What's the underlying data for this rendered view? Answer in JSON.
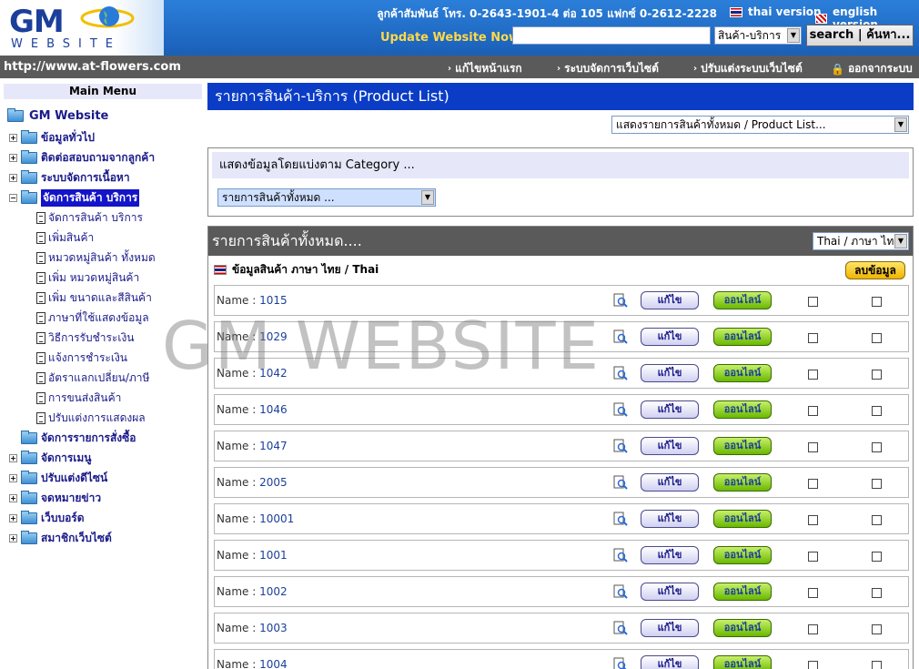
{
  "header": {
    "logo_main": "GM",
    "logo_sub": "WEBSITE",
    "contact": "ลูกค้าสัมพันธ์ โทร. 0-2643-1901-4 ต่อ 105 แฟกซ์ 0-2612-2228",
    "thai_version": "thai version",
    "english_version": "english version",
    "update_label": "Update Website Now!",
    "search_value": "",
    "search_category": "สินค้า-บริการ",
    "search_button": "search | ค้นหา..."
  },
  "navbar": {
    "url": "http://www.at-flowers.com",
    "links": [
      "แก้ไขหน้าแรก",
      "ระบบจัดการเว็บไซต์",
      "ปรับแต่งระบบเว็บไซต์",
      "ออกจากระบบ"
    ]
  },
  "sidebar": {
    "title": "Main Menu",
    "root": "GM Website",
    "items": [
      "ข้อมูลทั่วไป",
      "ติดต่อสอบถามจากลูกค้า",
      "ระบบจัดการเนื้อหา",
      "จัดการสินค้า บริการ",
      "จัดการรายการสั่งซื้อ",
      "จัดการเมนู",
      "ปรับแต่งดีไซน์",
      "จดหมายข่าว",
      "เว็บบอร์ด",
      "สมาชิกเว็บไซต์"
    ],
    "subitems": [
      "จัดการสินค้า บริการ",
      "เพิ่มสินค้า",
      "หมวดหมู่สินค้า ทั้งหมด",
      "เพิ่ม หมวดหมู่สินค้า",
      "เพิ่ม ขนาดและสีสินค้า",
      "ภาษาที่ใช้แสดงข้อมูล",
      "วิธีการรับชำระเงิน",
      "แจ้งการชำระเงิน",
      "อัตราแลกเปลี่ยน/ภาษี",
      "การขนส่งสินค้า",
      "ปรับแต่งการแสดงผล"
    ]
  },
  "main": {
    "page_title": "รายการสินค้า-บริการ (Product List)",
    "list_select": "แสดงรายการสินค้าทั้งหมด / Product List...",
    "category_heading": "แสดงข้อมูลโดยแบ่งตาม Category ...",
    "category_select": "รายการสินค้าทั้งหมด ...",
    "list_heading": "รายการสินค้าทั้งหมด....",
    "lang_filter": "Thai / ภาษา ไทย",
    "lang_row": "ข้อมูลสินค้า ภาษา ไทย / Thai",
    "delete_button": "ลบข้อมูล",
    "name_label": "Name : ",
    "edit_label": "แก้ไข",
    "online_label": "ออนไลน์",
    "rows": [
      "1015",
      "1029",
      "1042",
      "1046",
      "1047",
      "2005",
      "10001",
      "1001",
      "1002",
      "1003",
      "1004"
    ]
  },
  "watermark": "GM WEBSITE"
}
